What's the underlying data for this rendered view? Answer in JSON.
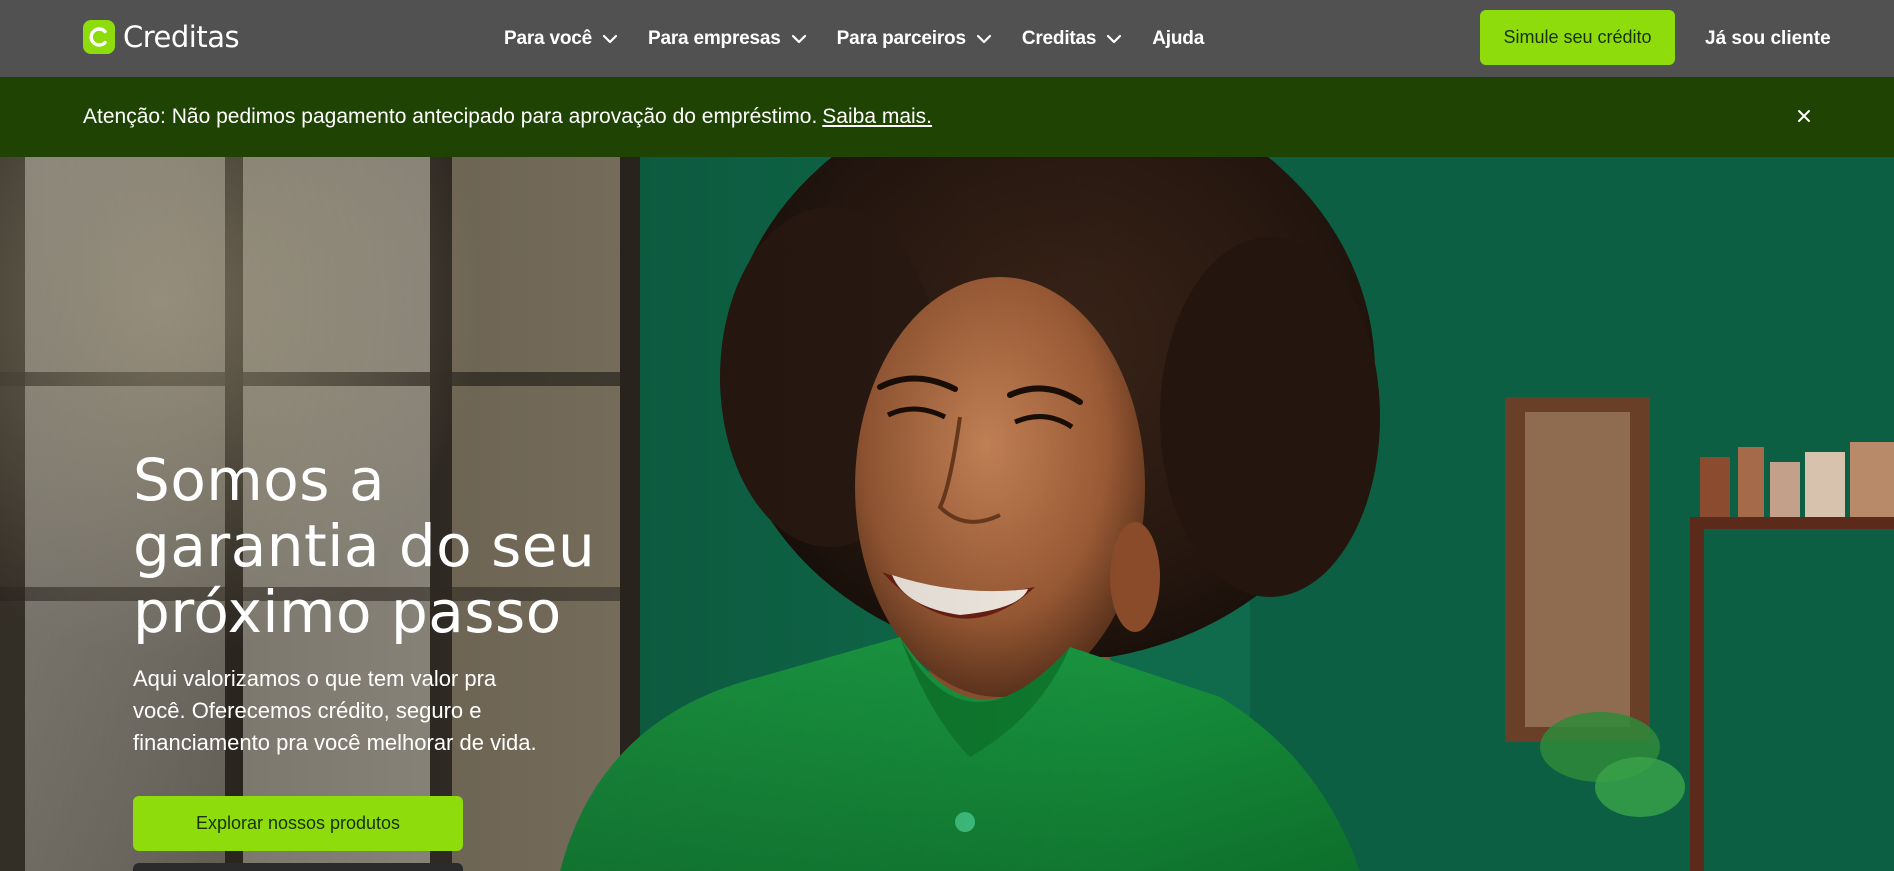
{
  "brand": {
    "name": "Creditas",
    "logo_color": "#8fdc0c",
    "logo_icon": "creditas-c-icon"
  },
  "nav": {
    "items": [
      {
        "label": "Para você",
        "icon": "chevron-down-icon"
      },
      {
        "label": "Para empresas",
        "icon": "chevron-down-icon"
      },
      {
        "label": "Para parceiros",
        "icon": "chevron-down-icon"
      },
      {
        "label": "Creditas",
        "icon": "chevron-down-icon"
      },
      {
        "label": "Ajuda"
      }
    ],
    "cta_label": "Simule seu crédito",
    "client_label": "Já sou cliente"
  },
  "alert": {
    "text": "Atenção: Não pedimos pagamento antecipado para aprovação do empréstimo.",
    "link_label": "Saiba mais.",
    "close_icon": "close-icon"
  },
  "hero": {
    "title_lines": [
      "Somos a",
      "garantia do seu",
      "próximo passo"
    ],
    "subtitle_lines": [
      "Aqui valorizamos o que tem valor pra",
      "você. Oferecemos crédito, seguro e",
      "financiamento pra você melhorar de vida."
    ],
    "primary_button": "Explorar nossos produtos"
  },
  "colors": {
    "topbar_bg": "#515151",
    "alert_bg": "#1f4303",
    "accent": "#8fdc0c",
    "accent_text": "#173103"
  }
}
